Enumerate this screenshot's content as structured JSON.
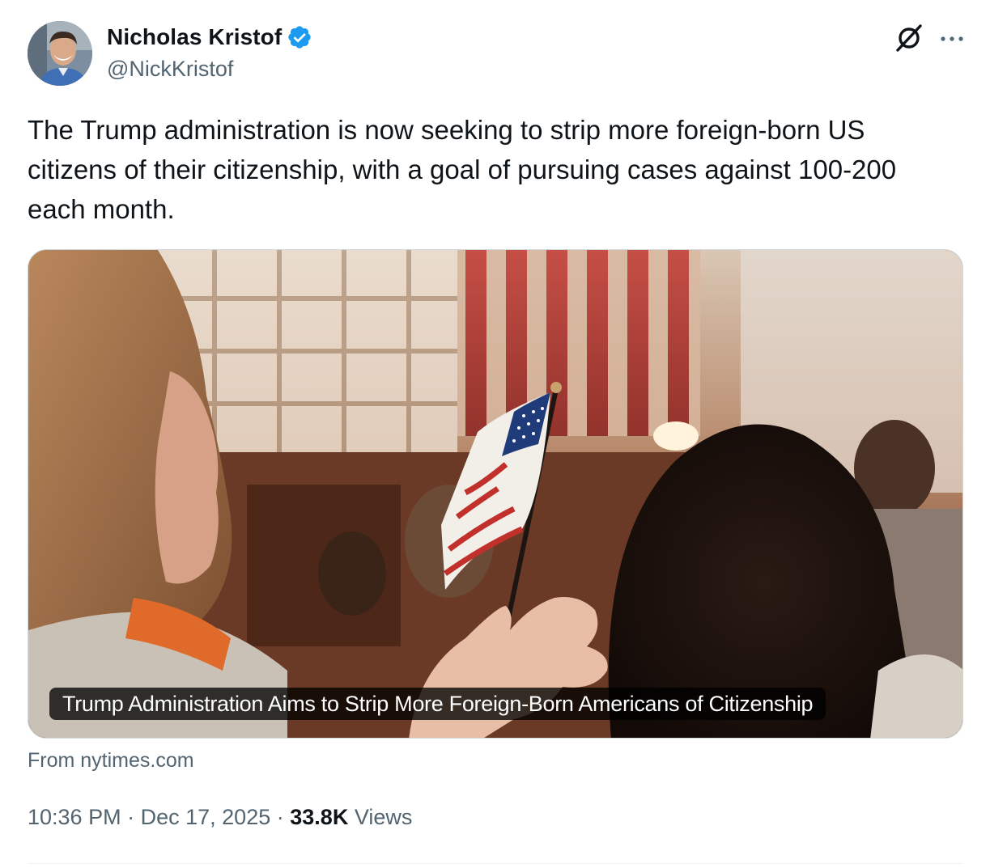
{
  "author": {
    "display_name": "Nicholas Kristof",
    "handle": "@NickKristof",
    "verified": true
  },
  "header_icons": {
    "grok": "grok-icon",
    "more": "more-dots-icon"
  },
  "tweet": {
    "text": "The Trump administration is now seeking to strip more foreign-born US citizens of their citizenship, with a goal of pursuing cases against 100-200 each month."
  },
  "link_card": {
    "headline": "Trump Administration Aims to Strip More Foreign-Born Americans of Citizenship",
    "source": "From nytimes.com",
    "image_description": "photo"
  },
  "meta": {
    "time": "10:36 PM",
    "separator": "·",
    "date": "Dec 17, 2025",
    "views_count": "33.8K",
    "views_label": "Views"
  },
  "colors": {
    "text_primary": "#0f1419",
    "text_secondary": "#536471",
    "verified_blue": "#1d9bf0",
    "border": "#cfd9de"
  }
}
